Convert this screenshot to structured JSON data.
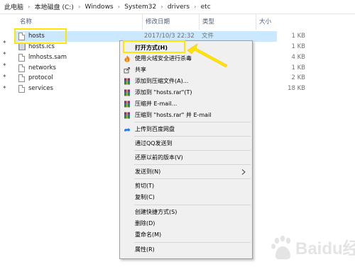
{
  "breadcrumb": [
    "此电脑",
    "本地磁盘 (C:)",
    "Windows",
    "System32",
    "drivers",
    "etc"
  ],
  "columns": {
    "name": "名称",
    "date": "修改日期",
    "type": "类型",
    "size": "大小"
  },
  "files": [
    {
      "name": "hosts",
      "date": "2017/10/3 22:32",
      "type": "文件",
      "size": "1 KB",
      "icon": "file-icon"
    },
    {
      "name": "hosts.ics",
      "size": "1 KB",
      "icon": "ics-file-icon"
    },
    {
      "name": "lmhosts.sam",
      "size": "4 KB",
      "icon": "file-icon"
    },
    {
      "name": "networks",
      "size": "1 KB",
      "icon": "file-icon"
    },
    {
      "name": "protocol",
      "size": "2 KB",
      "icon": "file-icon"
    },
    {
      "name": "services",
      "size": "18 KB",
      "icon": "file-icon"
    }
  ],
  "context_menu": {
    "open_with": "打开方式(H)",
    "huorong_scan": "使用火绒安全进行杀毒",
    "share": "共享",
    "add_to_archive": "添加到压缩文件(A)...",
    "add_to_hosts_rar": "添加到 \"hosts.rar\"(T)",
    "compress_email": "压缩并 E-mail...",
    "compress_hosts_email": "压缩到 \"hosts.rar\" 并 E-mail",
    "upload_baidu": "上传到百度网盘",
    "send_qq": "通过QQ发送到",
    "restore_previous": "还原以前的版本(V)",
    "send_to": "发送到(N)",
    "cut": "剪切(T)",
    "copy": "复制(C)",
    "create_shortcut": "创建快捷方式(S)",
    "delete": "删除(D)",
    "rename": "重命名(M)",
    "properties": "属性(R)"
  },
  "colors": {
    "selection": "#cce8ff",
    "highlight": "#ffe600",
    "menu_bg": "#f0f0f0"
  },
  "watermark": {
    "text": "Baidu经验"
  }
}
